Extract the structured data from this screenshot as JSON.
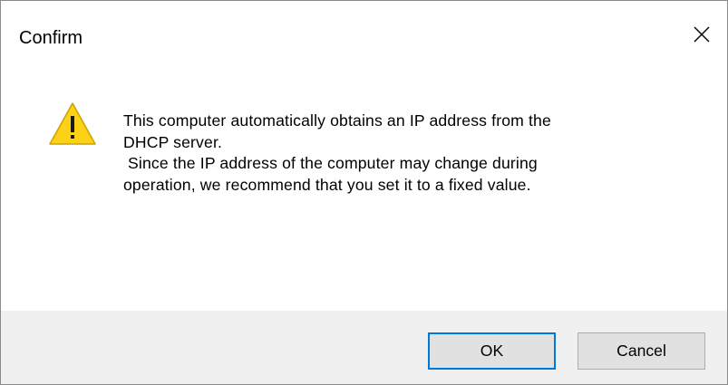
{
  "window": {
    "title": "Confirm",
    "close_icon": "close-icon"
  },
  "message": {
    "icon": "warning-icon",
    "lines": [
      "This computer automatically obtains an IP address from the",
      "DHCP server.",
      " Since the IP address of the computer may change during",
      "operation, we recommend that you set it to a fixed value."
    ]
  },
  "buttons": {
    "ok_label": "OK",
    "cancel_label": "Cancel"
  },
  "colors": {
    "warning_fill": "#fcd116",
    "default_button_border": "#0078d7",
    "footer_background": "#f0f0f0"
  }
}
